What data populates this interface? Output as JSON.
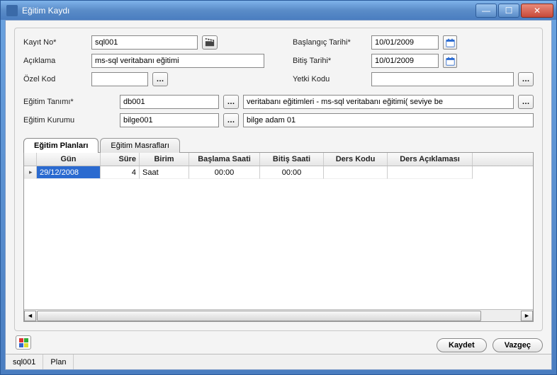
{
  "window": {
    "title": "Eğitim Kaydı"
  },
  "labels": {
    "kayit_no": "Kayıt No*",
    "aciklama": "Açıklama",
    "ozel_kod": "Özel Kod",
    "baslangic_tarihi": "Başlangıç Tarihi*",
    "bitis_tarihi": "Bitiş Tarihi*",
    "yetki_kodu": "Yetki Kodu",
    "egitim_tanimi": "Eğitim Tanımı*",
    "egitim_kurumu": "Eğitim Kurumu"
  },
  "fields": {
    "kayit_no": "sql001",
    "aciklama": "ms-sql veritabanı eğitimi",
    "ozel_kod": "",
    "baslangic_tarihi": "10/01/2009",
    "bitis_tarihi": "10/01/2009",
    "yetki_kodu": "",
    "egitim_tanimi_kod": "db001",
    "egitim_tanimi_aciklama": "veritabanı eğitimleri - ms-sql veritabanı eğitimi( seviye be",
    "egitim_kurumu_kod": "bilge001",
    "egitim_kurumu_aciklama": "bilge adam 01"
  },
  "tabs": {
    "planlari": "Eğitim Planları",
    "masraflari": "Eğitim Masrafları"
  },
  "grid": {
    "headers": {
      "gun": "Gün",
      "sure": "Süre",
      "birim": "Birim",
      "baslama": "Başlama Saati",
      "bitis": "Bitiş Saati",
      "ders_kodu": "Ders Kodu",
      "ders_aciklamasi": "Ders Açıklaması"
    },
    "rows": [
      {
        "gun": "29/12/2008",
        "sure": "4",
        "birim": "Saat",
        "baslama": "00:00",
        "bitis": "00:00",
        "ders_kodu": "",
        "ders_aciklamasi": ""
      }
    ]
  },
  "buttons": {
    "kaydet": "Kaydet",
    "vazgec": "Vazgeç"
  },
  "statusbar": {
    "c1": "sql001",
    "c2": "Plan"
  }
}
